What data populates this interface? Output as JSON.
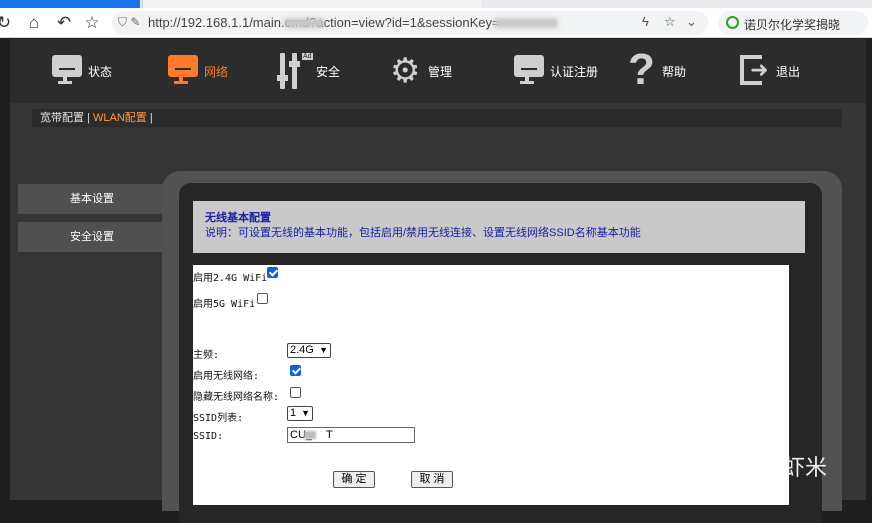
{
  "browser": {
    "url_text": "http://192.168.1.1/main.cmd?action=view?id=1&sessionKey=",
    "search_text": "诺贝尔化学奖揭晓"
  },
  "topnav": {
    "items": [
      {
        "label": "状态",
        "icon": "monitor-icon"
      },
      {
        "label": "网络",
        "icon": "monitor-icon",
        "active": true
      },
      {
        "label": "安全",
        "icon": "sliders-icon"
      },
      {
        "label": "管理",
        "icon": "gears-icon"
      },
      {
        "label": "认证注册",
        "icon": "monitor-icon"
      },
      {
        "label": "帮助",
        "icon": "question-icon"
      },
      {
        "label": "退出",
        "icon": "exit-icon"
      }
    ]
  },
  "breadcrumb": {
    "first": "宽带配置",
    "sep": " | ",
    "current": "WLAN配置",
    "tail": " |"
  },
  "sidebar": {
    "items": [
      {
        "label": "基本设置"
      },
      {
        "label": "安全设置"
      }
    ]
  },
  "info": {
    "title": "无线基本配置",
    "desc": "说明：可设置无线的基本功能，包括启用/禁用无线连接、设置无线网络SSID名称基本功能"
  },
  "form": {
    "wifi24_label": "启用2.4G WiFi",
    "wifi24_checked": true,
    "wifi5_label": "启用5G WiFi",
    "wifi5_checked": false,
    "band_label": "主频:",
    "band_value": "2.4G",
    "enable_wireless_label": "启用无线网络:",
    "enable_wireless_checked": true,
    "hide_ssid_label": "隐藏无线网络名称:",
    "hide_ssid_checked": false,
    "ssid_list_label": "SSID列表:",
    "ssid_list_value": "1",
    "ssid_label": "SSID:",
    "ssid_value": "CU_",
    "ssid_value_end": "T",
    "confirm_label": "确 定",
    "cancel_label": "取 消"
  },
  "watermark": "知乎 @虾米",
  "colors": {
    "accent": "#ff7a2b",
    "info_text": "#1a20a8",
    "checkbox": "#0b64d6"
  }
}
